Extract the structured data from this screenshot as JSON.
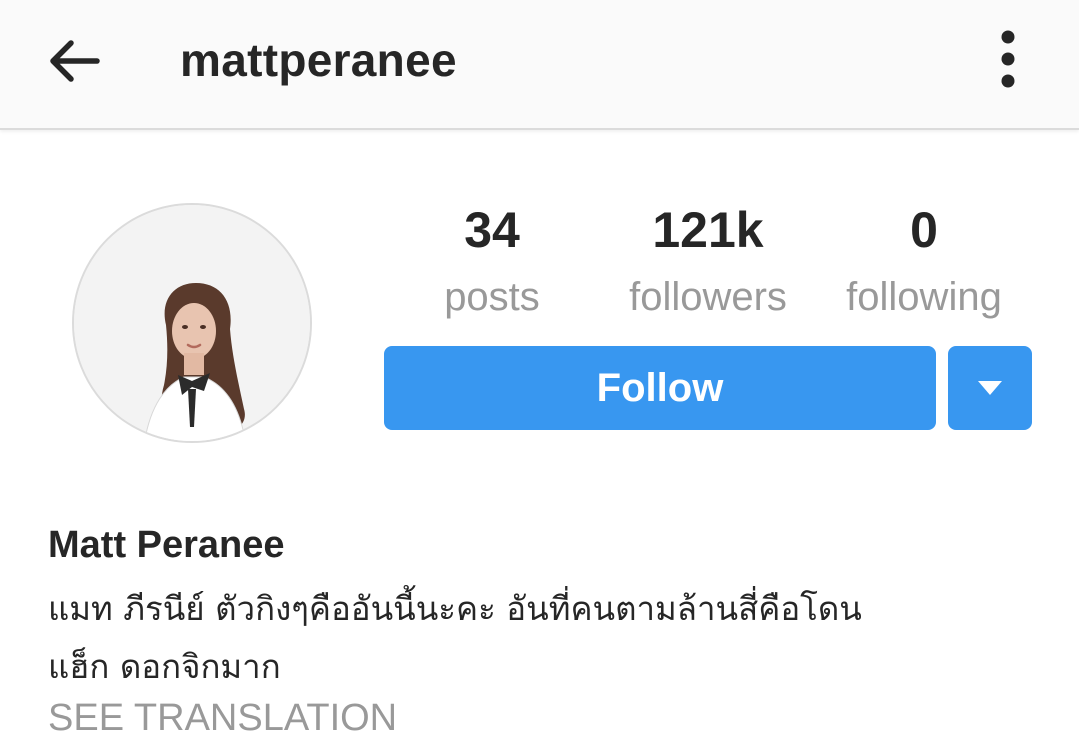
{
  "header": {
    "username": "mattperanee",
    "back_icon": "arrow-left-icon",
    "menu_icon": "more-vertical-icon"
  },
  "profile": {
    "avatar_icon": "profile-photo",
    "stats": [
      {
        "value": "34",
        "label": "posts"
      },
      {
        "value": "121k",
        "label": "followers"
      },
      {
        "value": "0",
        "label": "following"
      }
    ],
    "follow_label": "Follow",
    "dropdown_icon": "triangle-down-icon",
    "full_name": "Matt Peranee",
    "bio_line1": "แมท ภีรนีย์ ตัวกิงๆคืออันนี้นะคะ อันที่คนตามล้านสี่คือโดน",
    "bio_line2": "แฮ็ก ดอกจิกมาก",
    "see_translation": "SEE TRANSLATION"
  },
  "colors": {
    "accent": "#3897f0",
    "text": "#262626",
    "muted": "#999999",
    "header_bg": "#fafafa"
  }
}
